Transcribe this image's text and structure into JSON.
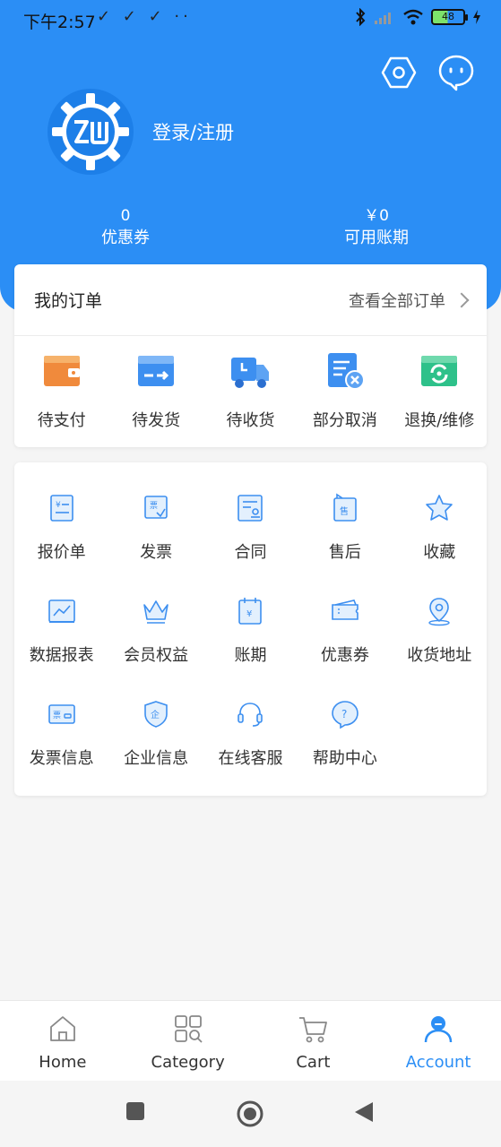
{
  "status_bar": {
    "time": "下午2:57",
    "left_icons": "✓ ✓ ✓ ··",
    "battery": "48"
  },
  "header": {
    "login_label": "登录/注册",
    "coupon": {
      "value": "0",
      "label": "优惠券"
    },
    "credit": {
      "value": "￥0",
      "label": "可用账期"
    }
  },
  "orders": {
    "title": "我的订单",
    "view_all": "查看全部订单",
    "items": [
      {
        "label": "待支付",
        "icon": "wallet-icon"
      },
      {
        "label": "待发货",
        "icon": "shipping-box-icon"
      },
      {
        "label": "待收货",
        "icon": "delivery-truck-icon"
      },
      {
        "label": "部分取消",
        "icon": "partial-cancel-icon"
      },
      {
        "label": "退换/维修",
        "icon": "return-repair-icon"
      }
    ]
  },
  "services": {
    "rows": [
      [
        {
          "label": "报价单",
          "icon": "quotation-icon"
        },
        {
          "label": "发票",
          "icon": "invoice-icon"
        },
        {
          "label": "合同",
          "icon": "contract-icon"
        },
        {
          "label": "售后",
          "icon": "after-sales-icon"
        },
        {
          "label": "收藏",
          "icon": "star-icon"
        }
      ],
      [
        {
          "label": "数据报表",
          "icon": "report-chart-icon"
        },
        {
          "label": "会员权益",
          "icon": "crown-icon"
        },
        {
          "label": "账期",
          "icon": "credit-period-icon"
        },
        {
          "label": "优惠券",
          "icon": "coupon-icon"
        },
        {
          "label": "收货地址",
          "icon": "location-pin-icon"
        }
      ],
      [
        {
          "label": "发票信息",
          "icon": "invoice-info-icon"
        },
        {
          "label": "企业信息",
          "icon": "enterprise-shield-icon"
        },
        {
          "label": "在线客服",
          "icon": "headset-icon"
        },
        {
          "label": "帮助中心",
          "icon": "help-icon"
        }
      ]
    ]
  },
  "tabbar": [
    {
      "label": "Home",
      "icon": "home-icon"
    },
    {
      "label": "Category",
      "icon": "category-grid-icon"
    },
    {
      "label": "Cart",
      "icon": "cart-icon"
    },
    {
      "label": "Account",
      "icon": "account-icon",
      "active": true
    }
  ],
  "colors": {
    "brand": "#2b8ef5",
    "background": "#f5f5f5",
    "order_orange": "#f08a3c",
    "order_blue": "#3d8ff0",
    "order_green": "#2ec18a"
  }
}
